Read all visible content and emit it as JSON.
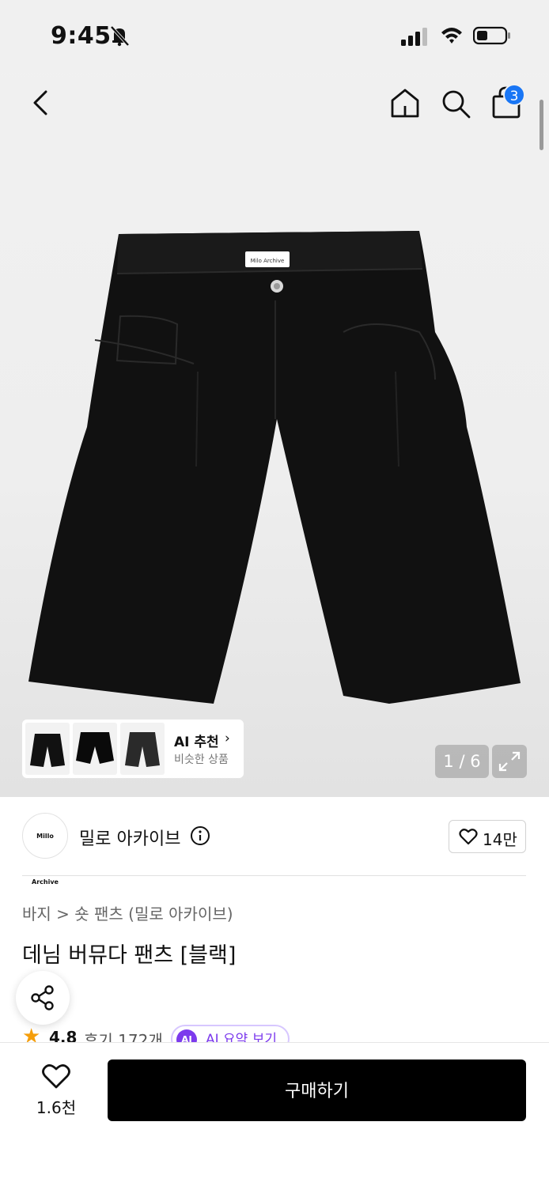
{
  "status_bar": {
    "time": "9:45"
  },
  "header": {
    "cart_count": "3"
  },
  "product_image": {
    "brand_tag": "Milo Archive"
  },
  "gallery": {
    "ai_title": "AI 추천",
    "ai_subtitle": "비슷한 상품",
    "page_indicator": "1 / 6"
  },
  "brand": {
    "logo_text": "Millo Archive",
    "name": "밀로 아카이브",
    "likes": "14만"
  },
  "product": {
    "breadcrumb": "바지 > 숏 팬츠 (밀로 아카이브)",
    "title": "데님 버뮤다 팬츠 [블랙]",
    "rating": "4.8",
    "reviews": "후기 172개",
    "ai_summary_icon": "AI",
    "ai_summary": "AI 요약 보기"
  },
  "bottom_bar": {
    "wish_count": "1.6천",
    "buy_label": "구매하기"
  },
  "colors": {
    "accent": "#1976f5",
    "ai_purple": "#7c3aed",
    "buy": "#000000"
  }
}
